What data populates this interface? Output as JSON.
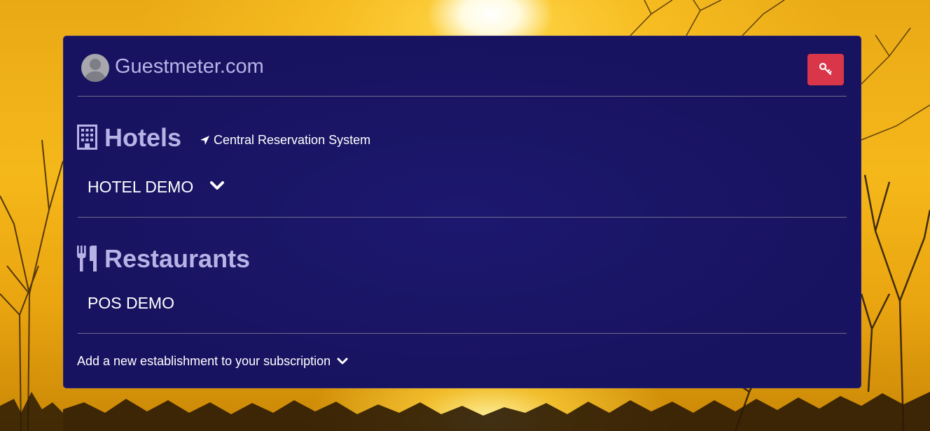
{
  "brand": {
    "name": "Guestmeter.com",
    "avatar_icon": "user-avatar-icon",
    "login_icon": "key-icon",
    "login_button_color": "#d9364a"
  },
  "hotels": {
    "title": "Hotels",
    "icon": "building-icon",
    "crs_link": "Central Reservation System",
    "crs_icon": "location-arrow-icon",
    "establishments": [
      "HOTEL DEMO"
    ]
  },
  "restaurants": {
    "title": "Restaurants",
    "icon": "utensils-icon",
    "establishments": [
      "POS DEMO"
    ]
  },
  "footer": {
    "add_establishment": "Add a new establishment to your subscription"
  },
  "colors": {
    "panel": "#1a1565",
    "heading": "#b8b3e6",
    "text": "#ffffff"
  }
}
